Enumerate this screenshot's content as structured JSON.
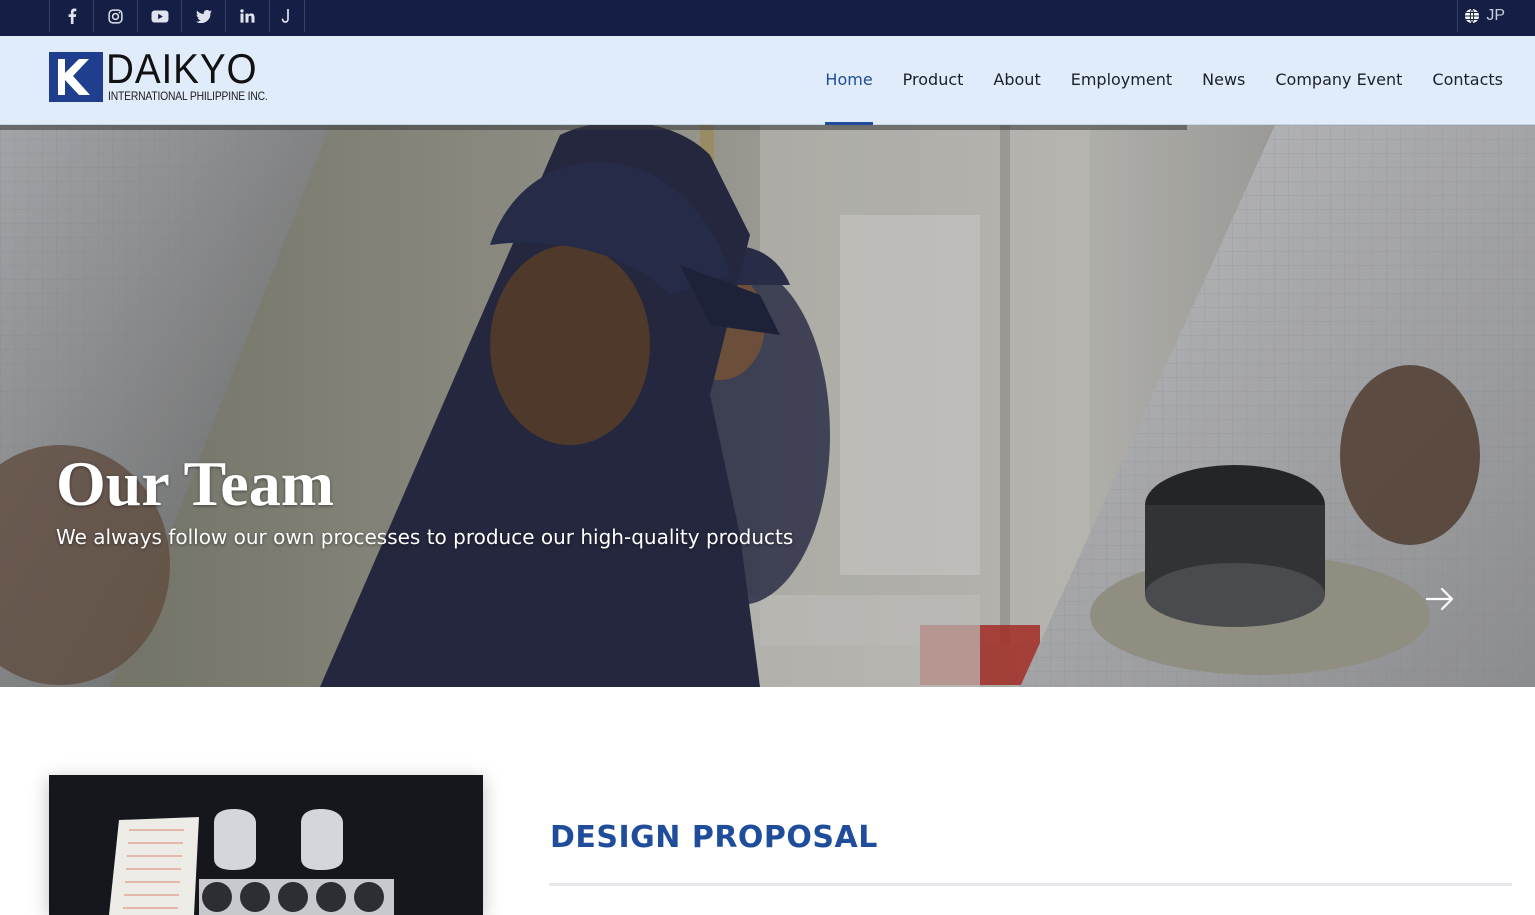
{
  "topbar": {
    "social": [
      {
        "icon": "facebook-icon"
      },
      {
        "icon": "instagram-icon"
      },
      {
        "icon": "youtube-icon"
      },
      {
        "icon": "twitter-icon"
      },
      {
        "icon": "linkedin-icon"
      },
      {
        "icon": "tiktok-icon"
      }
    ],
    "language": {
      "icon": "globe-icon",
      "label": "JP"
    }
  },
  "header": {
    "logo": {
      "word": "DAIKYO",
      "subtitle": "INTERNATIONAL PHILIPPINE INC."
    },
    "nav": [
      {
        "label": "Home",
        "active": true
      },
      {
        "label": "Product",
        "active": false
      },
      {
        "label": "About",
        "active": false
      },
      {
        "label": "Employment",
        "active": false
      },
      {
        "label": "News",
        "active": false
      },
      {
        "label": "Company Event",
        "active": false
      },
      {
        "label": "Contacts",
        "active": false
      }
    ]
  },
  "hero": {
    "title": "Our Team",
    "subtitle": "We always follow our own processes to produce our high-quality products",
    "next_icon": "arrow-right-icon"
  },
  "section": {
    "title": "DESIGN PROPOSAL"
  },
  "colors": {
    "topbar_bg": "#151e44",
    "header_bg": "#e0ecfa",
    "accent": "#1f4d9b"
  }
}
